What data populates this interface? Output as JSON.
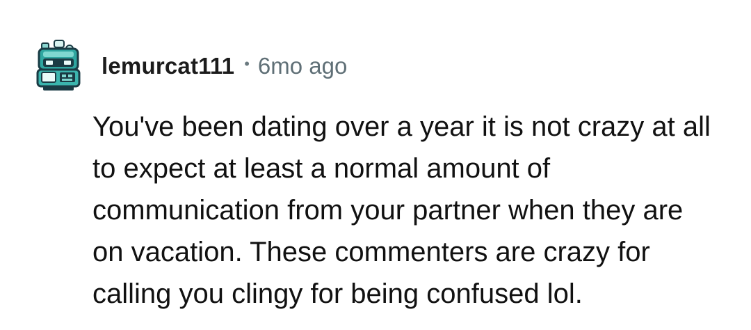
{
  "comment": {
    "author": {
      "username": "lemurcat111",
      "avatar_icon": "robot-avatar-icon"
    },
    "separator": "•",
    "timestamp": "6mo ago",
    "body": "You've been dating over a year it is not crazy at all to expect at least a normal amount of communication from your partner when they are on vacation. These commenters are crazy for calling you clingy for being confused lol."
  },
  "colors": {
    "username": "#1c1c1c",
    "meta": "#5f6f76",
    "text": "#111111",
    "avatar_primary": "#2fa6a0",
    "avatar_dark": "#1a3b44"
  }
}
